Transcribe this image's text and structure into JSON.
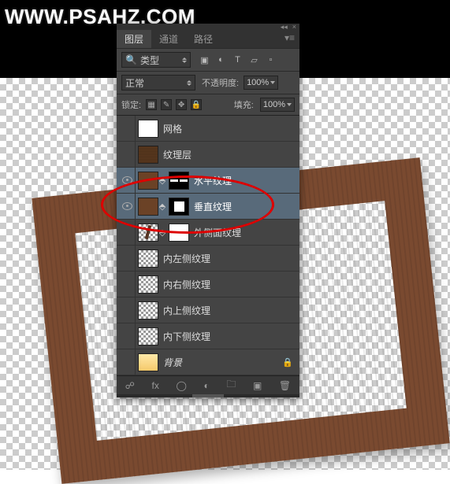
{
  "watermark": "WWW.PSAHZ.COM",
  "panel": {
    "tabs": {
      "layers": "图层",
      "channels": "通道",
      "paths": "路径"
    },
    "filter": {
      "kind": "类型"
    },
    "blend": {
      "mode": "正常",
      "opacity_label": "不透明度:",
      "opacity_value": "100%"
    },
    "lock": {
      "label": "锁定:",
      "fill_label": "填充:",
      "fill_value": "100%"
    }
  },
  "layers": [
    {
      "name": "网格",
      "visible": false,
      "selected": false,
      "thumb": "white",
      "mask": null,
      "linked": false
    },
    {
      "name": "纹理层",
      "visible": false,
      "selected": false,
      "thumb": "texture",
      "mask": null,
      "linked": false
    },
    {
      "name": "水平纹理",
      "visible": true,
      "selected": true,
      "thumb": "brown",
      "mask": "mask-hbars",
      "linked": true
    },
    {
      "name": "垂直纹理",
      "visible": true,
      "selected": true,
      "thumb": "brown",
      "mask": "mask-sq",
      "linked": true
    },
    {
      "name": "外侧面纹理",
      "visible": false,
      "selected": false,
      "thumb": "stick",
      "mask": "white",
      "linked": true
    },
    {
      "name": "内左侧纹理",
      "visible": false,
      "selected": false,
      "thumb": "checker",
      "mask": null,
      "linked": false
    },
    {
      "name": "内右侧纹理",
      "visible": false,
      "selected": false,
      "thumb": "checker",
      "mask": null,
      "linked": false
    },
    {
      "name": "内上侧纹理",
      "visible": false,
      "selected": false,
      "thumb": "checker",
      "mask": null,
      "linked": false
    },
    {
      "name": "内下侧纹理",
      "visible": false,
      "selected": false,
      "thumb": "checker",
      "mask": null,
      "linked": false
    },
    {
      "name": "背景",
      "visible": false,
      "selected": false,
      "thumb": "gradient",
      "mask": null,
      "linked": false,
      "locked": true,
      "italic": true
    }
  ],
  "colors": {
    "panel_bg": "#444444",
    "selected_bg": "#586a7a",
    "wood": "#7a4a30",
    "ellipse": "#d00000"
  }
}
